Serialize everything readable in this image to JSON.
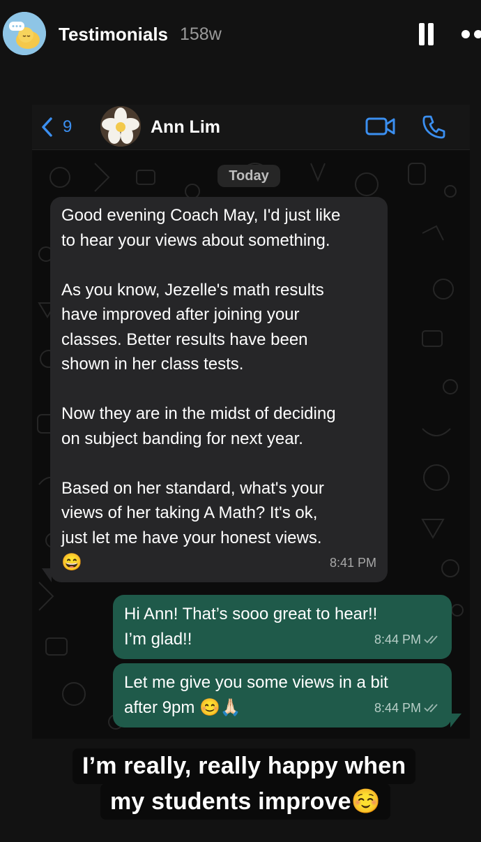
{
  "story": {
    "title": "Testimonials",
    "age": "158w"
  },
  "chat": {
    "back_count": "9",
    "contact_name": "Ann Lim",
    "date_label": "Today",
    "incoming": {
      "text": "Good evening Coach May, I'd just like\nto hear your views about something.\n\nAs you know, Jezelle's math results\nhave improved after joining your\nclasses. Better results have been\nshown in her class tests.\n\nNow they are in the midst of deciding\non subject banding for next year.\n\nBased on her standard, what's your\nviews of her taking A Math? It's ok,\njust let me have your honest views.\n😄",
      "time": "8:41 PM"
    },
    "outgoing": [
      {
        "text": "Hi Ann! That’s sooo great to hear!!\nI’m glad!!",
        "time": "8:44 PM"
      },
      {
        "text": "Let me give you some views in a bit\nafter 9pm 😊🙏🏻",
        "time": "8:44 PM"
      }
    ]
  },
  "caption": {
    "line1": "I’m really, really happy when",
    "line2": "my students improve☺️"
  },
  "colors": {
    "accent_blue": "#3b8ff0",
    "incoming_bubble": "#262628",
    "outgoing_bubble": "#1f5a4a"
  },
  "icons": {
    "back": "chevron-left-icon",
    "video": "video-camera-icon",
    "call": "phone-icon",
    "pause": "pause-icon",
    "more": "more-dots-icon",
    "read": "double-check-icon"
  }
}
